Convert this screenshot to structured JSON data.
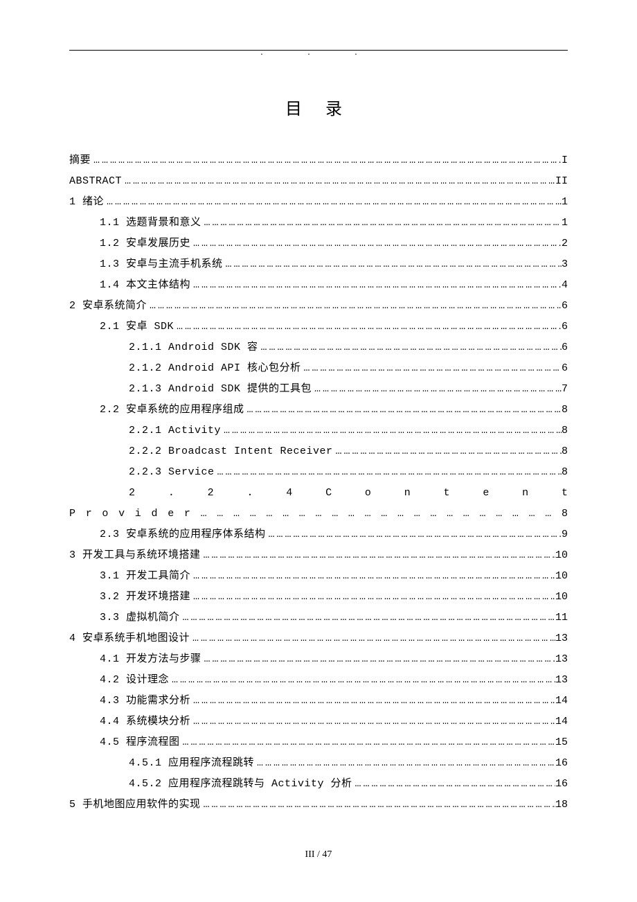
{
  "title": "目 录",
  "footer": "III / 47",
  "toc": [
    {
      "level": 0,
      "label": "摘要",
      "page": "I"
    },
    {
      "level": 0,
      "label": "ABSTRACT",
      "page": "II"
    },
    {
      "level": 0,
      "label": "1 绪论",
      "page": "1"
    },
    {
      "level": 1,
      "label": "1.1 选题背景和意义",
      "page": "1"
    },
    {
      "level": 1,
      "label": "1.2 安卓发展历史",
      "page": "2"
    },
    {
      "level": 1,
      "label": "1.3 安卓与主流手机系统",
      "page": "3"
    },
    {
      "level": 1,
      "label": "1.4 本文主体结构",
      "page": "4"
    },
    {
      "level": 0,
      "label": "2 安卓系统简介",
      "page": "6"
    },
    {
      "level": 1,
      "label": "2.1 安卓 SDK",
      "page": "6"
    },
    {
      "level": 2,
      "label": "2.1.1 Android SDK 容",
      "page": "6"
    },
    {
      "level": 2,
      "label": "2.1.2 Android API 核心包分析",
      "page": "6"
    },
    {
      "level": 2,
      "label": "2.1.3 Android SDK 提供的工具包",
      "page": "7"
    },
    {
      "level": 1,
      "label": "2.2 安卓系统的应用程序组成",
      "page": "8"
    },
    {
      "level": 2,
      "label": "2.2.1 Activity",
      "page": "8"
    },
    {
      "level": 2,
      "label": "2.2.2 Broadcast Intent Receiver",
      "page": "8"
    },
    {
      "level": 2,
      "label": "2.2.3 Service",
      "page": "8"
    },
    {
      "level": -1,
      "justified_lines": [
        "2 . 2 . 4     C o n t e n t",
        "P r o v i d e r  … … … … … … … … … … … … … … … … … … … … … … 8"
      ]
    },
    {
      "level": 1,
      "label": "2.3 安卓系统的应用程序体系结构",
      "page": "9"
    },
    {
      "level": 0,
      "label": "3 开发工具与系统环境搭建",
      "page": "10"
    },
    {
      "level": 1,
      "label": "3.1 开发工具简介",
      "page": "10"
    },
    {
      "level": 1,
      "label": "3.2 开发环境搭建",
      "page": "10"
    },
    {
      "level": 1,
      "label": "3.3 虚拟机简介",
      "page": "11"
    },
    {
      "level": 0,
      "label": "4 安卓系统手机地图设计",
      "page": "13"
    },
    {
      "level": 1,
      "label": "4.1 开发方法与步骤",
      "page": "13"
    },
    {
      "level": 1,
      "label": "4.2 设计理念",
      "page": "13"
    },
    {
      "level": 1,
      "label": "4.3 功能需求分析",
      "page": "14"
    },
    {
      "level": 1,
      "label": "4.4 系统模块分析",
      "page": "14"
    },
    {
      "level": 1,
      "label": "4.5 程序流程图",
      "page": "15"
    },
    {
      "level": 2,
      "label": "4.5.1 应用程序流程跳转",
      "page": "16"
    },
    {
      "level": 2,
      "label": "4.5.2 应用程序流程跳转与 Activity 分析",
      "page": "16"
    },
    {
      "level": 0,
      "label": "5 手机地图应用软件的实现",
      "page": "18"
    }
  ]
}
